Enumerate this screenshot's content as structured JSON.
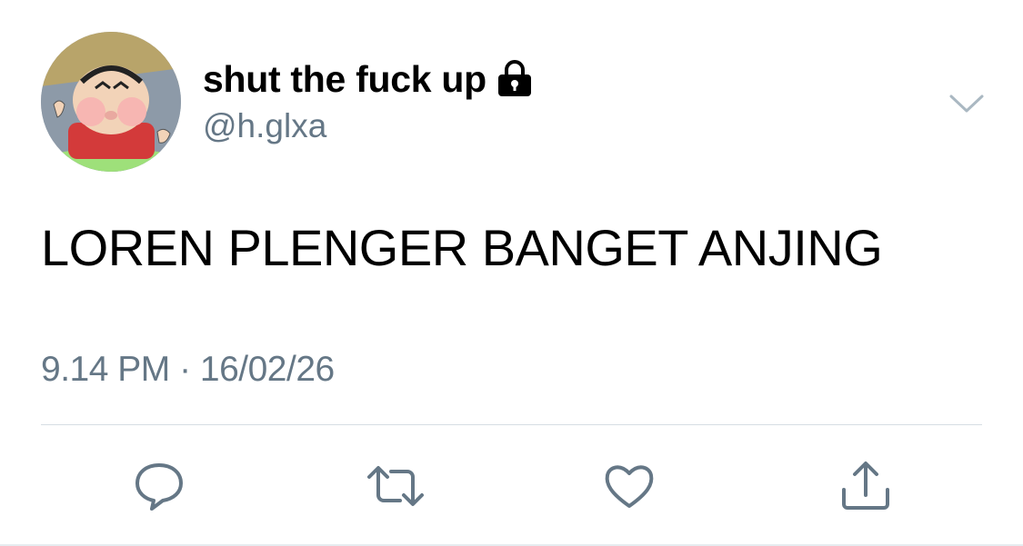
{
  "tweet": {
    "display_name": "shut the fuck up",
    "handle": "@h.glxa",
    "text": "LOREN PLENGER BANGET ANJING",
    "timestamp": "9.14 PM · 16/02/26",
    "protected": true
  },
  "icons": {
    "avatar": "avatar",
    "lock": "lock-icon",
    "caret": "chevron-down-icon",
    "reply": "reply-icon",
    "retweet": "retweet-icon",
    "like": "heart-icon",
    "share": "share-icon"
  },
  "colors": {
    "text": "#000000",
    "secondary": "#657786",
    "divider": "#d6dde3",
    "background": "#ffffff"
  }
}
